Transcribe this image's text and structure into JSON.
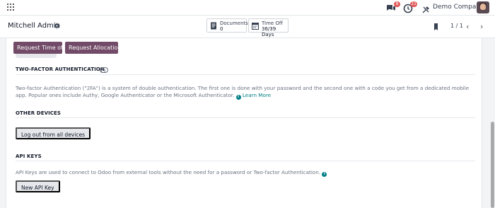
{
  "topbar": {
    "chat_badge": "8",
    "activity_badge": "21",
    "company": "Demo Company"
  },
  "control_panel": {
    "title": "Mitchell Admin",
    "stats": [
      {
        "label": "Documents",
        "value": "0"
      },
      {
        "label": "Time Off",
        "value": "36/39 Days"
      }
    ],
    "pager": "1 / 1"
  },
  "actions": {
    "request_time_off": "Request Time off",
    "request_allocation": "Request Allocation"
  },
  "two_factor": {
    "heading": "TWO-FACTOR AUTHENTICATION",
    "description": "Two-factor Authentication (\"2FA\") is a system of double authentication. The first one is done with your password and the second one with a code you get from a dedicated mobile app. Popular ones include Authy, Google Authenticator or the Microsoft Authenticator.",
    "learn_more": "Learn More"
  },
  "other_devices": {
    "heading": "OTHER DEVICES",
    "button": "Log out from all devices"
  },
  "api_keys": {
    "heading": "API KEYS",
    "description": "API Keys are used to connect to Odoo from external tools without the need for a password or Two-factor Authentication.",
    "button": "New API Key"
  },
  "colors": {
    "primary": "#714b67",
    "link": "#017e84",
    "badge": "#e05a5a"
  }
}
